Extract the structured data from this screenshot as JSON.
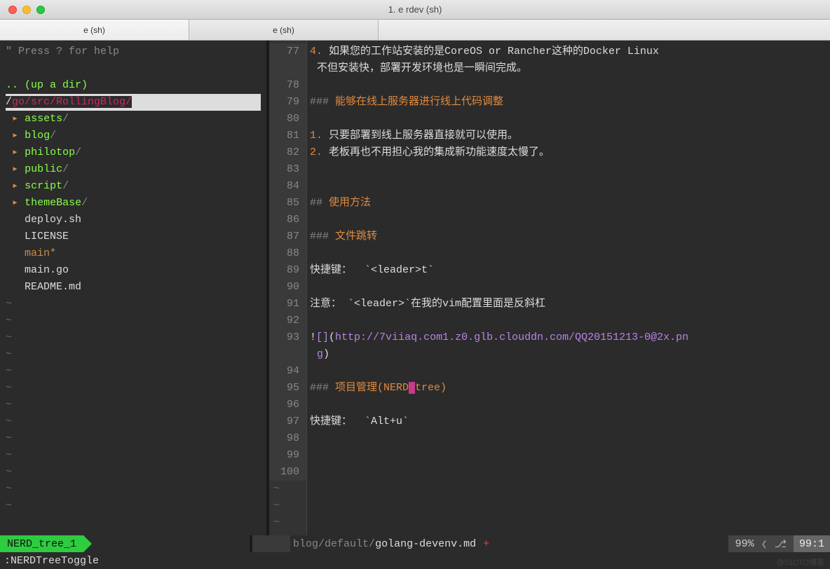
{
  "window": {
    "title": "1. e rdev (sh)"
  },
  "tabs": [
    {
      "label": "e (sh)",
      "active": true
    },
    {
      "label": "e (sh)",
      "active": false
    }
  ],
  "nerdtree": {
    "help": "\" Press ? for help",
    "updir": ".. (up a dir)",
    "path_prefix": "/",
    "path": "go/src/RollingBlog/",
    "items": [
      {
        "type": "dir",
        "name": "assets"
      },
      {
        "type": "dir",
        "name": "blog"
      },
      {
        "type": "dir",
        "name": "philotop"
      },
      {
        "type": "dir",
        "name": "public"
      },
      {
        "type": "dir",
        "name": "script"
      },
      {
        "type": "dir",
        "name": "themeBase"
      },
      {
        "type": "file",
        "name": "deploy.sh"
      },
      {
        "type": "file",
        "name": "LICENSE"
      },
      {
        "type": "file-mod",
        "name": "main*"
      },
      {
        "type": "file",
        "name": "main.go"
      },
      {
        "type": "file",
        "name": "README.md"
      }
    ]
  },
  "editor": {
    "lines": [
      {
        "n": 77,
        "segments": [
          {
            "cls": "orange-num",
            "t": "4."
          },
          {
            "cls": "white",
            "t": " 如果您的工作站安装的是CoreOS or Rancher这种的Docker Linux"
          }
        ],
        "cont": "不但安装快，部署开发环境也是一瞬间完成。"
      },
      {
        "n": 78,
        "segments": []
      },
      {
        "n": 79,
        "segments": [
          {
            "cls": "dim",
            "t": "### "
          },
          {
            "cls": "orange",
            "t": "能够在线上服务器进行线上代码调整"
          }
        ]
      },
      {
        "n": 80,
        "segments": []
      },
      {
        "n": 81,
        "segments": [
          {
            "cls": "orange-num",
            "t": "1."
          },
          {
            "cls": "white",
            "t": " 只要部署到线上服务器直接就可以使用。"
          }
        ]
      },
      {
        "n": 82,
        "segments": [
          {
            "cls": "orange-num",
            "t": "2."
          },
          {
            "cls": "white",
            "t": " 老板再也不用担心我的集成新功能速度太慢了。"
          }
        ]
      },
      {
        "n": 83,
        "segments": []
      },
      {
        "n": 84,
        "segments": []
      },
      {
        "n": 85,
        "segments": [
          {
            "cls": "dim",
            "t": "## "
          },
          {
            "cls": "orange",
            "t": "使用方法"
          }
        ]
      },
      {
        "n": 86,
        "segments": []
      },
      {
        "n": 87,
        "segments": [
          {
            "cls": "dim",
            "t": "### "
          },
          {
            "cls": "orange",
            "t": "文件跳转"
          }
        ]
      },
      {
        "n": 88,
        "segments": []
      },
      {
        "n": 89,
        "segments": [
          {
            "cls": "white",
            "t": "快捷键：  `<leader>t`"
          }
        ]
      },
      {
        "n": 90,
        "segments": []
      },
      {
        "n": 91,
        "segments": [
          {
            "cls": "white",
            "t": "注意： `<leader>`在我的vim配置里面是反斜杠"
          }
        ]
      },
      {
        "n": 92,
        "segments": []
      },
      {
        "n": 93,
        "segments": [
          {
            "cls": "white",
            "t": "!"
          },
          {
            "cls": "purple",
            "t": "[]"
          },
          {
            "cls": "white",
            "t": "("
          },
          {
            "cls": "purple",
            "t": "http://7viiaq.com1.z0.glb.clouddn.com/QQ20151213-0@2x.pn"
          }
        ],
        "cont_segments": [
          {
            "cls": "purple",
            "t": "g"
          },
          {
            "cls": "white",
            "t": ")"
          }
        ]
      },
      {
        "n": 94,
        "segments": []
      },
      {
        "n": 95,
        "segments": [
          {
            "cls": "dim",
            "t": "### "
          },
          {
            "cls": "orange",
            "t": "项目管理(NERD"
          },
          {
            "cls": "cursor-block",
            "t": " "
          },
          {
            "cls": "orange",
            "t": "tree)"
          }
        ]
      },
      {
        "n": 96,
        "segments": []
      },
      {
        "n": 97,
        "segments": [
          {
            "cls": "white",
            "t": "快捷键：  `Alt+u`"
          }
        ]
      },
      {
        "n": 98,
        "segments": []
      },
      {
        "n": 99,
        "segments": []
      },
      {
        "n": 100,
        "segments": []
      }
    ]
  },
  "status": {
    "left": "NERD_tree_1",
    "path_dim": "blog/default/",
    "path_file": "golang-devenv.md",
    "modified": "+",
    "percent": "99%",
    "chev": "❮",
    "branch_icon": "⎇",
    "position": "99:1"
  },
  "cmdline": ":NERDTreeToggle",
  "watermark": "@51CTO博客"
}
